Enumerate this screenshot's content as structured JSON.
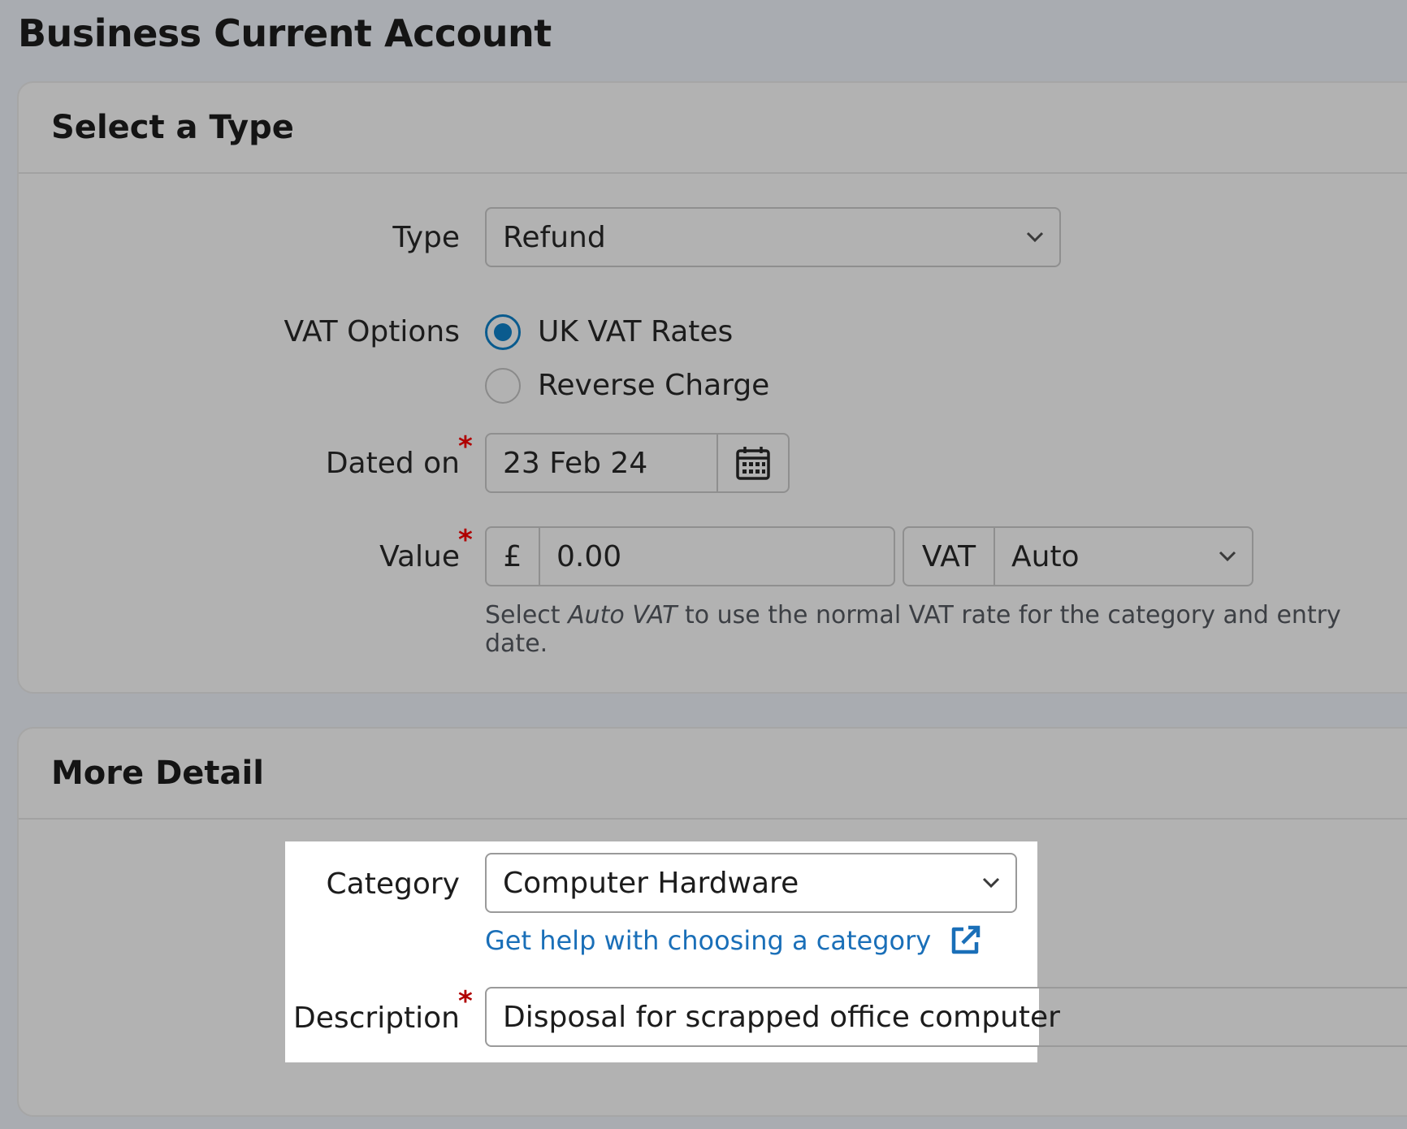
{
  "page": {
    "title": "Business Current Account"
  },
  "select_type": {
    "title": "Select a Type",
    "type_label": "Type",
    "type_value": "Refund",
    "vat_options_label": "VAT Options",
    "vat_options": [
      {
        "label": "UK VAT Rates",
        "selected": true
      },
      {
        "label": "Reverse Charge",
        "selected": false
      }
    ],
    "dated_on_label": "Dated on",
    "dated_on_value": "23 Feb 24",
    "value_label": "Value",
    "currency_symbol": "£",
    "value_amount": "0.00",
    "vat_label": "VAT",
    "vat_value": "Auto",
    "hint_prefix": "Select ",
    "hint_emphasis": "Auto VAT",
    "hint_suffix": " to use the normal VAT rate for the category and entry date.",
    "required_marker": "*"
  },
  "more_detail": {
    "title": "More Detail",
    "category_label": "Category",
    "category_value": "Computer Hardware",
    "help_link": "Get help with choosing a category",
    "description_label": "Description",
    "description_value": "Disposal for scrapped office computer"
  },
  "icons": {
    "chevron": "chevron-down-icon",
    "calendar": "calendar-icon",
    "external_link": "external-link-icon"
  },
  "colors": {
    "accent": "#0a5b8e",
    "link": "#1a6fb8",
    "required": "#b00000",
    "background": "#a9acb1",
    "panel": "#b2b2b2"
  }
}
